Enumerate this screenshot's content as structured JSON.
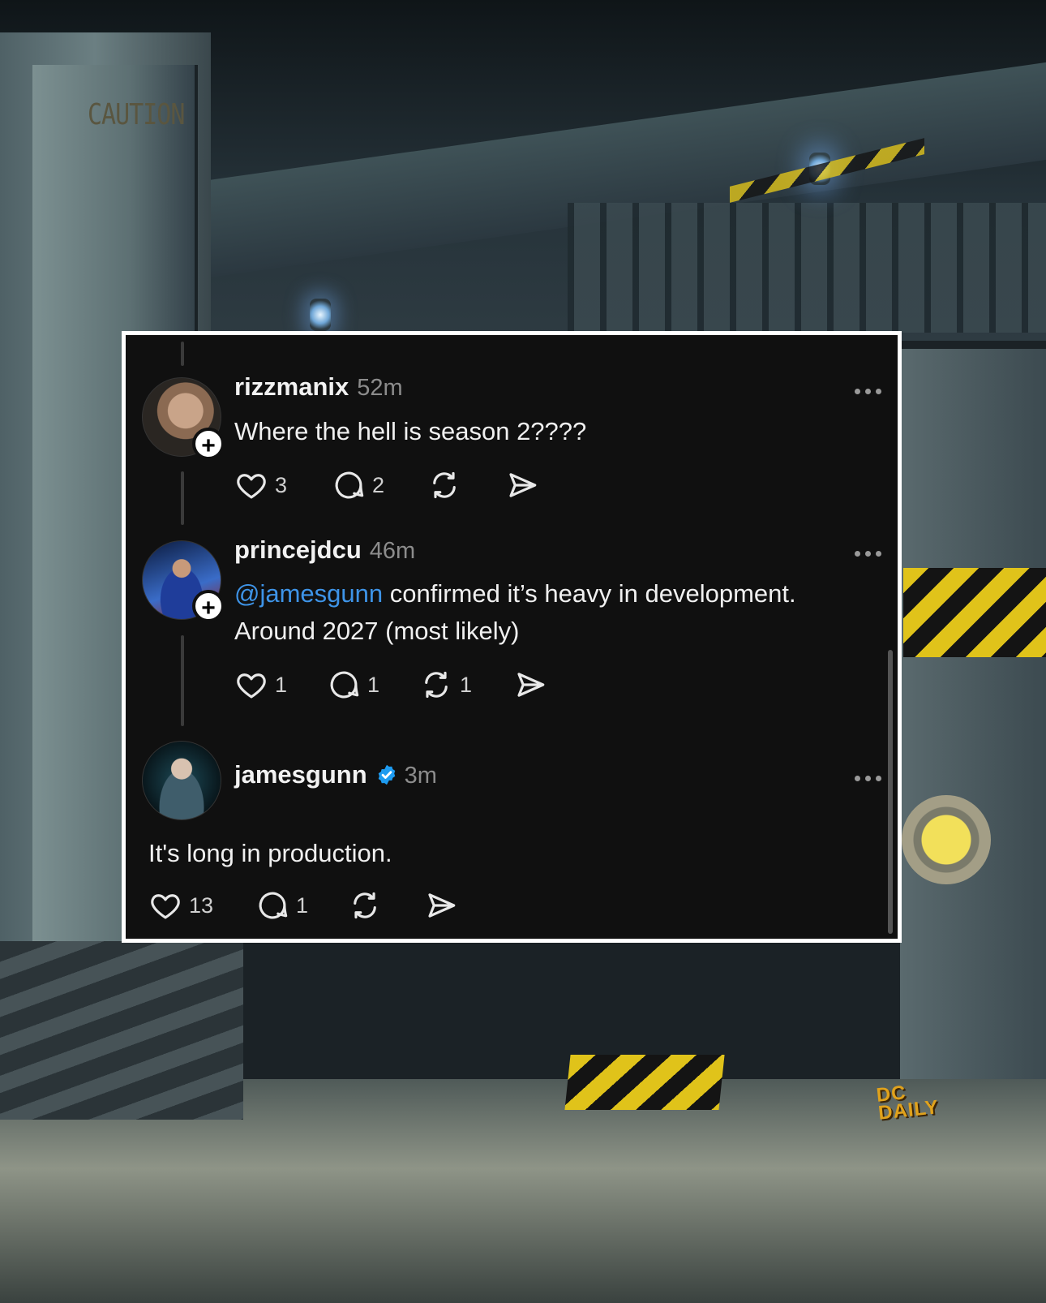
{
  "background": {
    "sign_text": "CAUTION",
    "watermark_logo": "DC DAILY",
    "accent_colors": {
      "hazard_yellow": "#e0c31a",
      "lamp_blue": "#6fa6d6"
    }
  },
  "colors": {
    "card_background": "#101010",
    "card_border": "#ffffff",
    "username": "#f2f2f2",
    "timestamp": "#8c8c8c",
    "mention": "#3e94e8",
    "verified_badge": "#1d9bf0"
  },
  "posts": [
    {
      "username": "rizzmanix",
      "time": "52m",
      "avatar_icon": "user-avatar",
      "follow_badge": "+",
      "text": "Where the hell is season 2????",
      "likes": "3",
      "replies": "2",
      "reposts": "",
      "has_more_menu": true
    },
    {
      "username": "princejdcu",
      "time": "46m",
      "avatar_icon": "user-avatar",
      "follow_badge": "+",
      "mention": "@jamesgunn",
      "text_line1": " confirmed it’s heavy in development.",
      "text_line2": "Around 2027 (most likely)",
      "likes": "1",
      "replies": "1",
      "reposts": "1",
      "has_more_menu": true
    },
    {
      "username": "jamesgunn",
      "verified": true,
      "time": "3m",
      "avatar_icon": "user-avatar",
      "text": "It's long in production.",
      "likes": "13",
      "replies": "1",
      "reposts": "",
      "has_more_menu": true
    }
  ]
}
